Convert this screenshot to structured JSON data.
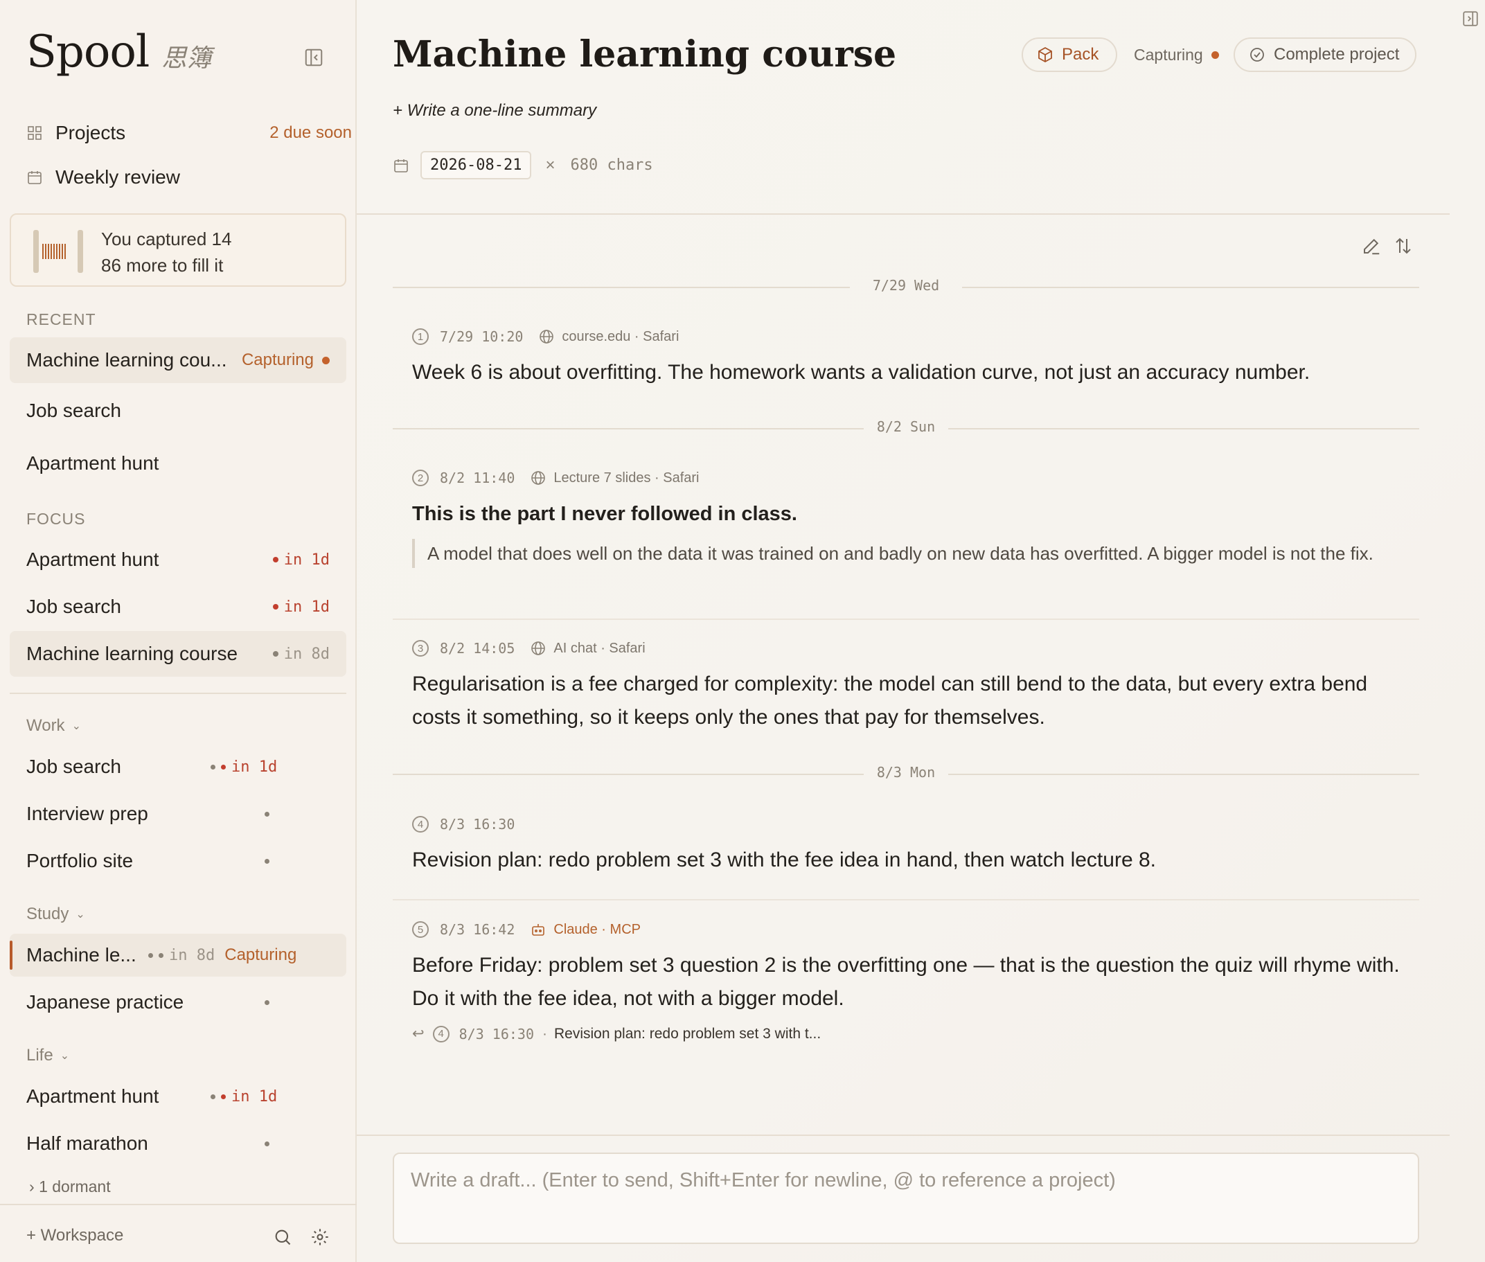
{
  "brand": {
    "name": "Spool",
    "subtitle": "思簿"
  },
  "nav": {
    "projects": {
      "label": "Projects",
      "badge": "2 due soon"
    },
    "weekly_review": {
      "label": "Weekly review"
    }
  },
  "spool_card": {
    "line1": "You captured 14",
    "line2": "86 more to fill it"
  },
  "recent": {
    "heading": "RECENT",
    "items": [
      {
        "label": "Machine learning cou...",
        "status": "Capturing"
      },
      {
        "label": "Job search"
      },
      {
        "label": "Apartment hunt"
      }
    ]
  },
  "focus": {
    "heading": "FOCUS",
    "items": [
      {
        "label": "Apartment hunt",
        "due": "in 1d"
      },
      {
        "label": "Job search",
        "due": "in 1d"
      },
      {
        "label": "Machine learning course",
        "due": "in 8d"
      }
    ]
  },
  "groups": {
    "work": {
      "label": "Work",
      "items": [
        {
          "label": "Job search",
          "due": "in 1d"
        },
        {
          "label": "Interview prep"
        },
        {
          "label": "Portfolio site"
        }
      ]
    },
    "study": {
      "label": "Study",
      "items": [
        {
          "label": "Machine le...",
          "due": "in 8d",
          "status": "Capturing"
        },
        {
          "label": "Japanese practice"
        }
      ]
    },
    "life": {
      "label": "Life",
      "items": [
        {
          "label": "Apartment hunt",
          "due": "in 1d"
        },
        {
          "label": "Half marathon"
        }
      ]
    },
    "dormant": "1 dormant"
  },
  "footer": {
    "workspace": "+ Workspace"
  },
  "header": {
    "title": "Machine learning course",
    "summary_prompt": "+ Write a one-line summary",
    "pack_label": "Pack",
    "status_label": "Capturing",
    "complete_label": "Complete project",
    "due_date": "2026-08-21",
    "clear": "×",
    "chars": "680 chars"
  },
  "days": [
    "7/29 Wed",
    "8/2 Sun",
    "8/3 Mon"
  ],
  "entries": [
    {
      "num": "1",
      "time": "7/29 10:20",
      "source": "course.edu · Safari",
      "text": "Week 6 is about overfitting. The homework wants a validation curve, not just an accuracy number."
    },
    {
      "num": "2",
      "time": "8/2 11:40",
      "source": "Lecture 7 slides · Safari",
      "text": "This is the part I never followed in class.",
      "quote": "A model that does well on the data it was trained on and badly on new data has overfitted. A bigger model is not the fix."
    },
    {
      "num": "3",
      "time": "8/2 14:05",
      "source": "AI chat · Safari",
      "text": "Regularisation is a fee charged for complexity: the model can still bend to the data, but every extra bend costs it something, so it keeps only the ones that pay for themselves."
    },
    {
      "num": "4",
      "time": "8/3 16:30",
      "text": "Revision plan: redo problem set 3 with the fee idea in hand, then watch lecture 8."
    },
    {
      "num": "5",
      "time": "8/3 16:42",
      "source": "Claude · MCP",
      "text": "Before Friday: problem set 3 question 2 is the overfitting one — that is the question the quiz will rhyme with. Do it with the fee idea, not with a bigger model.",
      "reply": {
        "num": "4",
        "time": "8/3 16:30",
        "snippet": "Revision plan: redo problem set 3 with t..."
      }
    }
  ],
  "composer": {
    "placeholder": "Write a draft... (Enter to send, Shift+Enter for newline, @ to reference a project)"
  },
  "colors": {
    "accent": "#b4612c",
    "due_red": "#b9432f",
    "background": "#f7f4ef"
  }
}
